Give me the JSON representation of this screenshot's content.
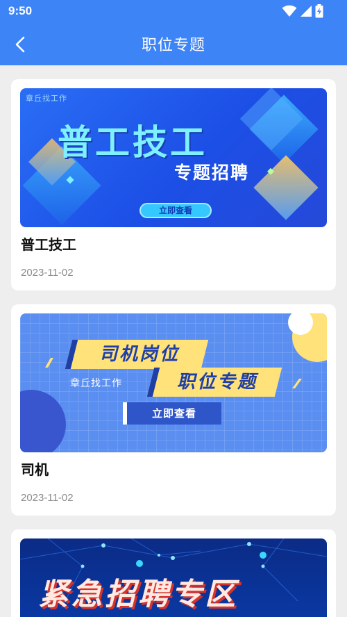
{
  "status_bar": {
    "time": "9:50",
    "icons": [
      "wifi-icon",
      "signal-icon",
      "battery-charging-icon"
    ]
  },
  "header": {
    "title": "职位专题",
    "back_icon": "chevron-left-icon"
  },
  "theme": {
    "primary": "#3d84f7",
    "background": "#eeeeee",
    "card": "#ffffff",
    "date_color": "#8c8c8c"
  },
  "topics": [
    {
      "title": "普工技工",
      "date": "2023-11-02",
      "banner": {
        "brand": "章丘找工作",
        "headline": "普工技工",
        "subheadline": "专题招聘",
        "cta": "立即查看"
      }
    },
    {
      "title": "司机",
      "date": "2023-11-02",
      "banner": {
        "brand": "章丘找工作",
        "headline": "司机岗位",
        "subheadline": "职位专题",
        "cta": "立即查看"
      }
    },
    {
      "banner": {
        "headline": "紧急招聘专区"
      }
    }
  ]
}
